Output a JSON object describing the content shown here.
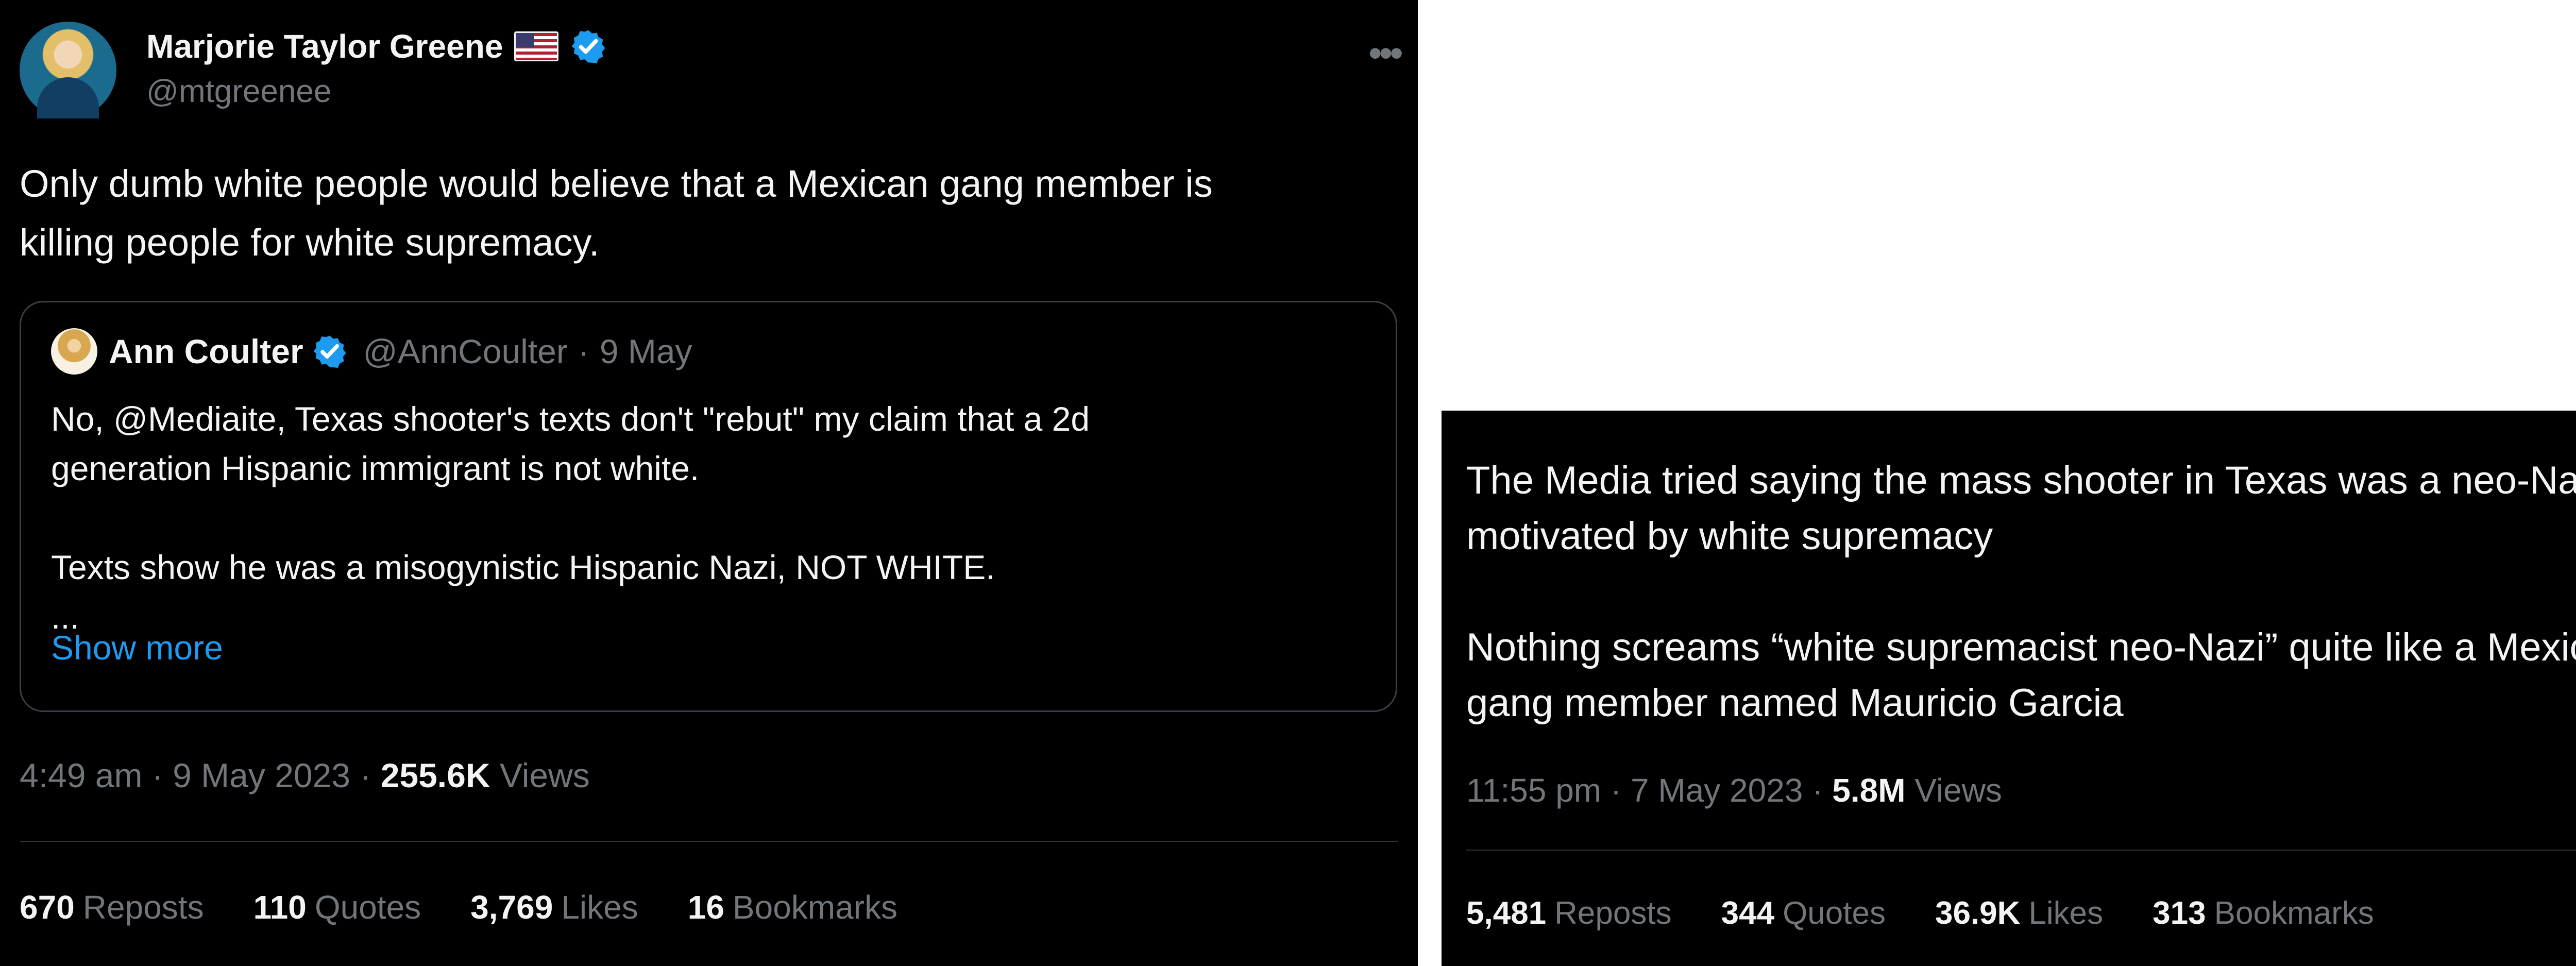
{
  "left_tweet": {
    "author": {
      "name": "Marjorie Taylor Greene",
      "handle": "@mtgreenee"
    },
    "text": "Only dumb white people would believe that a Mexican gang member is\nkilling people for white supremacy.",
    "quoted": {
      "name": "Ann Coulter",
      "handle": "@AnnCoulter",
      "separator": "·",
      "date": "9 May",
      "text": "No, @Mediaite, Texas shooter's texts don't \"rebut\" my claim that a 2d\ngeneration Hispanic immigrant is not white.\n\nTexts show he was a misogynistic Hispanic Nazi, NOT WHITE.\n...",
      "show_more": "Show more"
    },
    "meta": {
      "time_date": "4:49 am · 9 May 2023 ·",
      "views_count": "255.6K",
      "views_label": "Views"
    },
    "stats": [
      {
        "count": "670",
        "label": "Reposts"
      },
      {
        "count": "110",
        "label": "Quotes"
      },
      {
        "count": "3,769",
        "label": "Likes"
      },
      {
        "count": "16",
        "label": "Bookmarks"
      }
    ]
  },
  "right_tweet": {
    "text": "The Media tried saying the mass shooter in Texas was a neo-Nazi\nmotivated by white supremacy\n\nNothing screams “white supremacist neo-Nazi” quite like a Mexican\ngang member named Mauricio Garcia",
    "meta": {
      "time_date": "11:55 pm · 7 May 2023 ·",
      "views_count": "5.8M",
      "views_label": "Views"
    },
    "stats": [
      {
        "count": "5,481",
        "label": "Reposts"
      },
      {
        "count": "344",
        "label": "Quotes"
      },
      {
        "count": "36.9K",
        "label": "Likes"
      },
      {
        "count": "313",
        "label": "Bookmarks"
      }
    ]
  },
  "icons": {
    "author_avatar": "profile-photo-icon",
    "flag": "us-flag-icon",
    "verified": "verified-badge-icon",
    "more": "more-options-icon",
    "quote_avatar": "profile-photo-icon"
  },
  "colors": {
    "background": "#000000",
    "text": "#e7e9ea",
    "muted": "#71767b",
    "link": "#1d9bf0",
    "border": "#2f3336"
  }
}
